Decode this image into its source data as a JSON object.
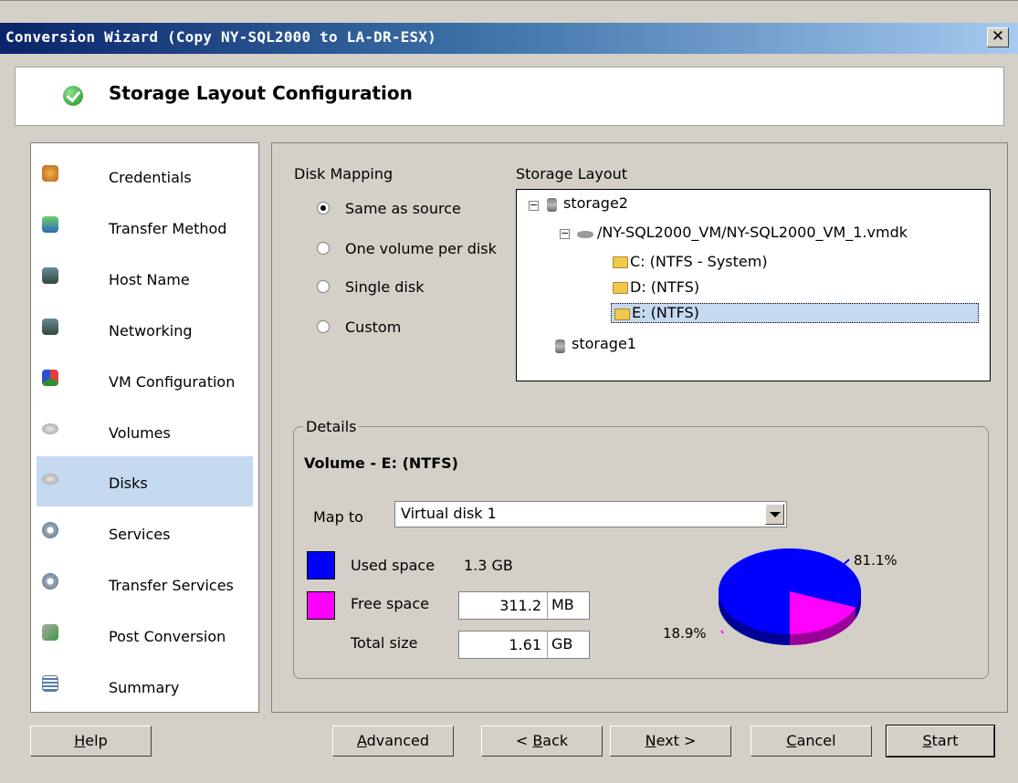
{
  "window": {
    "title": "Conversion Wizard (Copy NY-SQL2000 to LA-DR-ESX)",
    "close_label": "✕"
  },
  "header": {
    "title": "Storage Layout Configuration",
    "icon": "green-check-icon"
  },
  "nav": {
    "items": [
      {
        "label": "Credentials",
        "icon": "users-icon",
        "selected": false
      },
      {
        "label": "Transfer Method",
        "icon": "transfer-icon",
        "selected": false
      },
      {
        "label": "Host Name",
        "icon": "host-icon",
        "selected": false
      },
      {
        "label": "Networking",
        "icon": "network-icon",
        "selected": false
      },
      {
        "label": "VM Configuration",
        "icon": "vm-config-icon",
        "selected": false
      },
      {
        "label": "Volumes",
        "icon": "volume-icon",
        "selected": false
      },
      {
        "label": "Disks",
        "icon": "disk-icon",
        "selected": true
      },
      {
        "label": "Services",
        "icon": "gear-icon",
        "selected": false
      },
      {
        "label": "Transfer Services",
        "icon": "gear-icon",
        "selected": false
      },
      {
        "label": "Post Conversion",
        "icon": "post-conversion-icon",
        "selected": false
      },
      {
        "label": "Summary",
        "icon": "summary-icon",
        "selected": false
      }
    ]
  },
  "disk_mapping": {
    "label": "Disk Mapping",
    "options": [
      {
        "label": "Same as source",
        "selected": true
      },
      {
        "label": "One volume per disk",
        "selected": false
      },
      {
        "label": "Single disk",
        "selected": false
      },
      {
        "label": "Custom",
        "selected": false
      }
    ]
  },
  "storage_layout": {
    "label": "Storage Layout",
    "storage2": "storage2",
    "vmdk": "/NY-SQL2000_VM/NY-SQL2000_VM_1.vmdk",
    "vol_c": "C: (NTFS - System)",
    "vol_d": "D: (NTFS)",
    "vol_e": "E: (NTFS)",
    "storage1": "storage1",
    "expander": "−"
  },
  "details": {
    "legend": "Details",
    "volume_title": "Volume - E: (NTFS)",
    "map_to_label": "Map to",
    "map_to_value": "Virtual disk 1",
    "used_label": "Used space",
    "used_value": "1.3 GB",
    "free_label": "Free space",
    "free_value": "311.2",
    "free_unit": "MB",
    "total_label": "Total size",
    "total_value": "1.61",
    "total_unit": "GB",
    "used_color": "#0000ff",
    "free_color": "#ff00ff"
  },
  "chart_data": {
    "type": "pie",
    "slices": [
      {
        "label": "81.1%",
        "value": 81.1,
        "color": "#0000ff"
      },
      {
        "label": "18.9%",
        "value": 18.9,
        "color": "#ff00ff"
      }
    ]
  },
  "buttons": {
    "help_u": "H",
    "help_rest": "elp",
    "advanced_u": "A",
    "advanced_rest": "dvanced",
    "back_pre": "< ",
    "back_u": "B",
    "back_rest": "ack",
    "next_u": "N",
    "next_rest": "ext >",
    "cancel_u": "C",
    "cancel_rest": "ancel",
    "start_u": "S",
    "start_rest": "tart"
  }
}
